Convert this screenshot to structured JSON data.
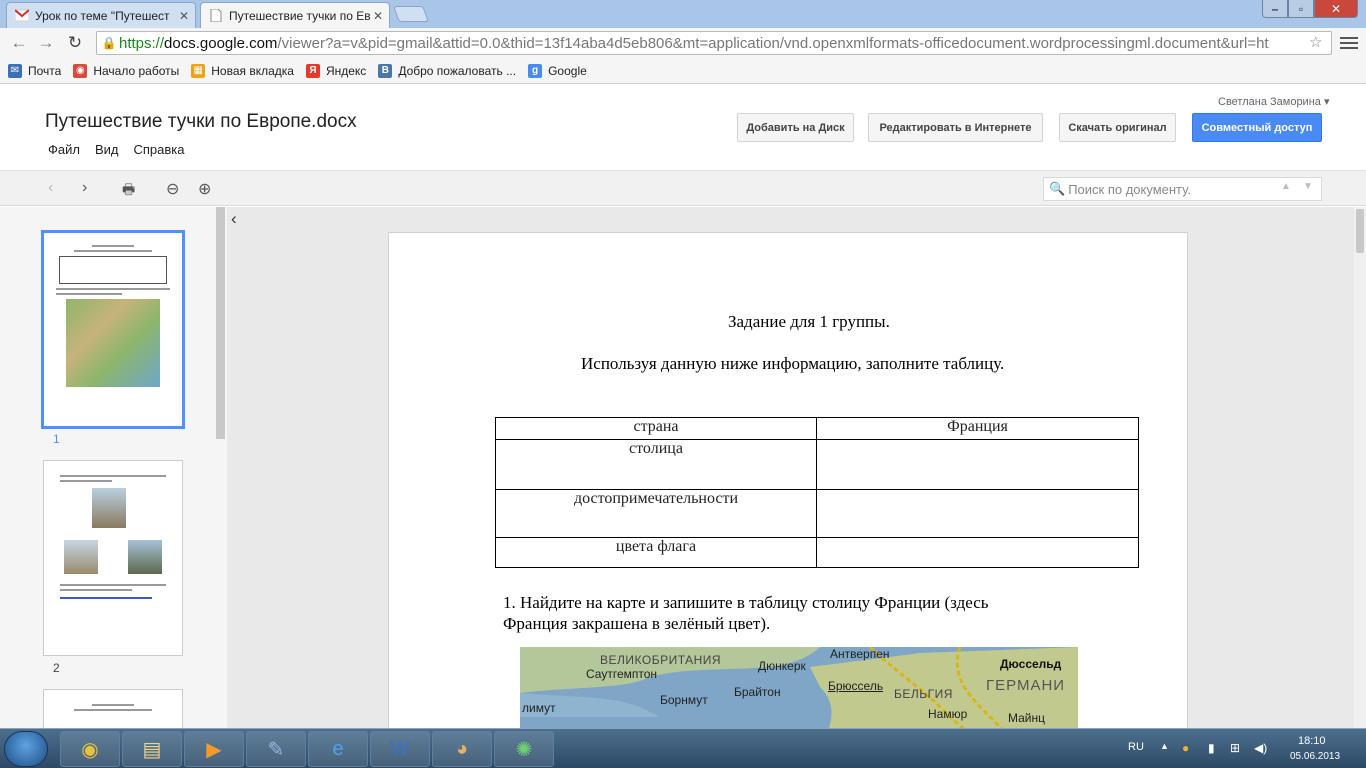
{
  "browser": {
    "tabs": [
      {
        "title": "Урок по теме \"Путешест",
        "favicon": "gmail-icon"
      },
      {
        "title": "Путешествие тучки по Ев",
        "favicon": "document-icon"
      }
    ],
    "address": {
      "scheme": "https://",
      "host": "docs.google.com",
      "rest": "/viewer?a=v&pid=gmail&attid=0.0&thid=13f14aba4d5eb806&mt=application/vnd.openxmlformats-officedocument.wordprocessingml.document&url=ht"
    },
    "bookmarks": [
      {
        "label": "Почта",
        "icon": "mail-icon",
        "color": "#3b6fb6"
      },
      {
        "label": "Начало работы",
        "icon": "chrome-icon",
        "color": "#d64b3b"
      },
      {
        "label": "Новая вкладка",
        "icon": "apps-grid-icon",
        "color": "#e8a317"
      },
      {
        "label": "Яндекс",
        "icon": "yandex-icon",
        "color": "#e23a2e"
      },
      {
        "label": "Добро пожаловать ...",
        "icon": "vk-icon",
        "color": "#4a76a8"
      },
      {
        "label": "Google",
        "icon": "google-icon",
        "color": "#4a8af4"
      }
    ]
  },
  "docs": {
    "title": "Путешествие тучки по Европе.docx",
    "menu": [
      "Файл",
      "Вид",
      "Справка"
    ],
    "user": "Светлана Заморина",
    "buttons": {
      "add_to_drive": "Добавить на Диск",
      "edit_online": "Редактировать в Интернете",
      "download": "Скачать оригинал",
      "share": "Совместный доступ"
    },
    "search_placeholder": "Поиск по документу.",
    "thumbnails": [
      {
        "page": "1"
      },
      {
        "page": "2"
      }
    ]
  },
  "page": {
    "heading": "Задание для 1 группы.",
    "instruction": "Используя данную ниже информацию, заполните таблицу.",
    "table": {
      "header": [
        "страна",
        "Франция"
      ],
      "rows": [
        [
          "столица",
          ""
        ],
        [
          "достопримечательности",
          ""
        ],
        [
          "цвета флага",
          ""
        ]
      ]
    },
    "task1_line1": "1. Найдите на карте  и запишите  в таблицу столицу Франции  (здесь",
    "task1_line2": "Франция закрашена в зелёный цвет).",
    "map_labels": {
      "uk": "ВЕЛИКОБРИТАНИЯ",
      "dunkirk": "Дюнкерк",
      "antwerp": "Антверпен",
      "dusseldorf": "Дюссельд",
      "southampton": "Саутгемптон",
      "brighton": "Брайтон",
      "brussels": "Брюссель",
      "belgium": "БЕЛЬГИЯ",
      "germany": "ГЕРМАНИ",
      "bournemouth": "Борнмут",
      "plymouth": "лимут",
      "namur": "Намюр",
      "mainz": "Майнц"
    }
  },
  "taskbar": {
    "apps": [
      "chrome-icon",
      "explorer-folder-icon",
      "media-player-icon",
      "paint-tools-icon",
      "ie-icon",
      "word-icon",
      "paint-palette-icon",
      "network-icon"
    ],
    "language": "RU",
    "time": "18:10",
    "date": "05.06.2013"
  }
}
